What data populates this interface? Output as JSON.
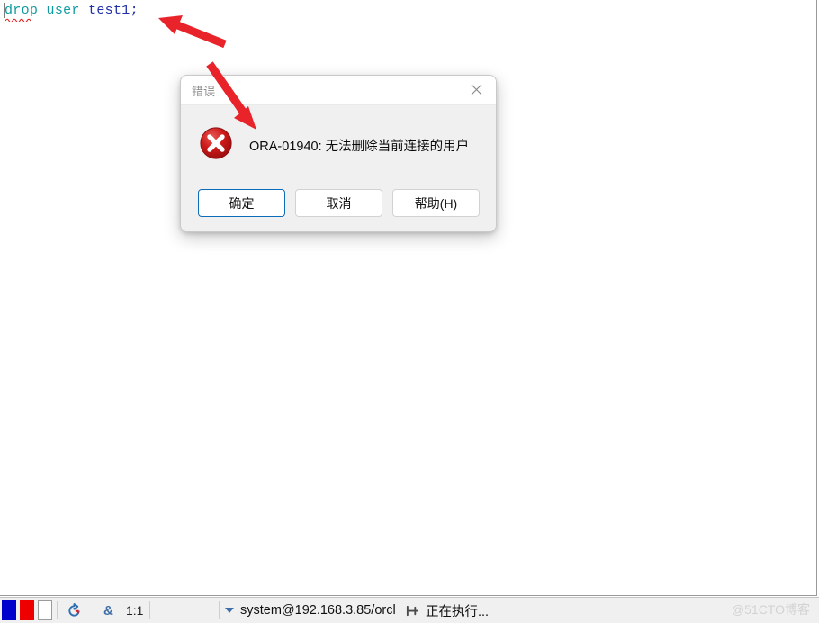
{
  "editor": {
    "code_tokens": [
      {
        "text": "drop",
        "type": "keyword"
      },
      {
        "text": " ",
        "type": "plain"
      },
      {
        "text": "user",
        "type": "keyword"
      },
      {
        "text": " ",
        "type": "plain"
      },
      {
        "text": "test1;",
        "type": "identifier"
      }
    ],
    "code_line": "drop user test1;",
    "keyword_1": "drop",
    "keyword_2": "user",
    "identifier": "test1;",
    "space": " "
  },
  "dialog": {
    "title": "错误",
    "close_label": "×",
    "message": "ORA-01940: 无法删除当前连接的用户",
    "icon": "error-circle-x-icon",
    "buttons": [
      {
        "label": "确定",
        "name": "ok-button",
        "focused": true
      },
      {
        "label": "取消",
        "name": "cancel-button",
        "focused": false
      },
      {
        "label": "帮助(H)",
        "name": "help-button",
        "focused": false
      }
    ],
    "ok_label": "确定",
    "cancel_label": "取消",
    "help_label": "帮助(H)"
  },
  "statusbar": {
    "cursor_position": "1:1",
    "ampersand": "&",
    "connection": "system@192.168.3.85/orcl",
    "execution_status": "正在执行...",
    "icons": {
      "refresh": "refresh-icon",
      "dropdown": "chevron-down-icon",
      "pin": "pin-icon"
    },
    "color_chips": [
      {
        "name": "color-chip-blue",
        "color": "#0000cc"
      },
      {
        "name": "color-chip-red",
        "color": "#ee0000"
      },
      {
        "name": "color-chip-white",
        "color": "#ffffff"
      }
    ]
  },
  "watermark": {
    "text": "@51CTO博客"
  },
  "annotations": {
    "arrow_color": "#e8242a",
    "arrow_1": "arrow-pointing-to-sql-statement",
    "arrow_2": "arrow-pointing-to-error-message"
  },
  "colors": {
    "keyword": "#0e9aa0",
    "identifier": "#1f2fa8",
    "focus_border": "#0c6cb8",
    "error_red": "#c00000",
    "dialog_bg": "#f0f0f0"
  }
}
